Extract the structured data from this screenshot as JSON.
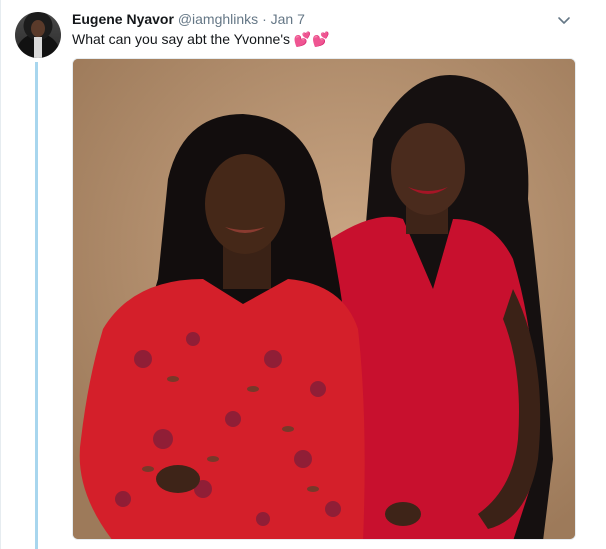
{
  "tweet": {
    "author_name": "Eugene Nyavor",
    "handle": "@iamghlinks",
    "separator": "·",
    "date": "Jan 7",
    "text": "What can you say abt the Yvonne's",
    "emoji": "💕💕"
  },
  "media": {
    "subject": "photo of two women"
  },
  "icons": {
    "avatar": "avatar",
    "caret": "chevron-down-icon"
  },
  "colors": {
    "thread_line": "#a8d6ee",
    "secondary_text": "#657786",
    "primary_text": "#14171a"
  }
}
